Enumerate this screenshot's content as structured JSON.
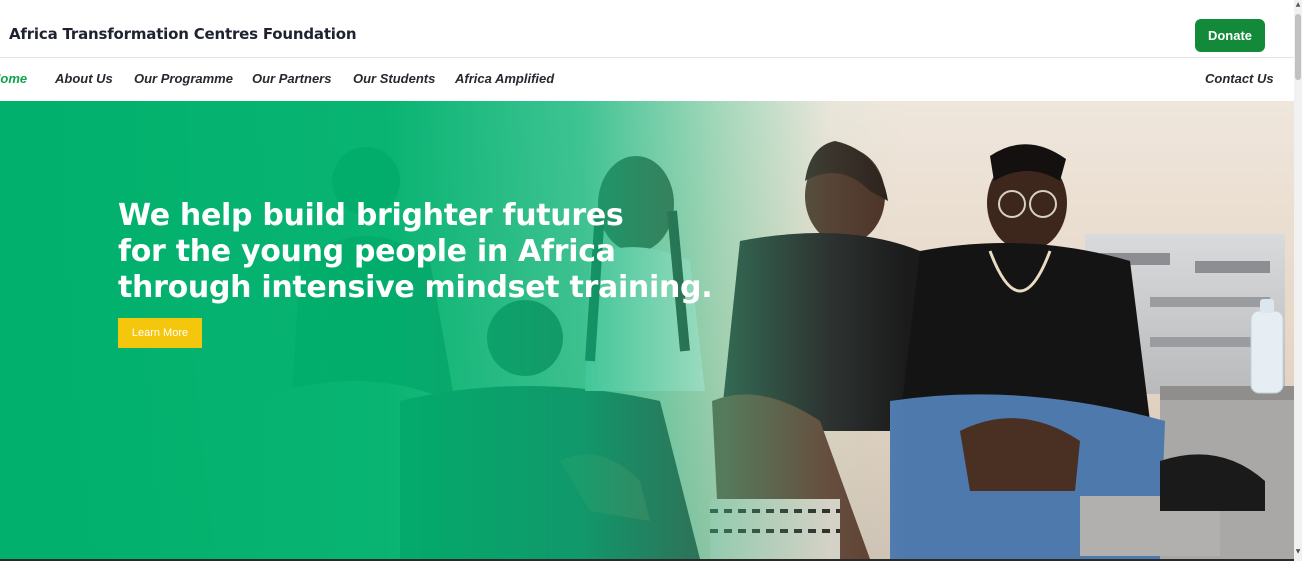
{
  "header": {
    "brand": "Africa Transformation Centres Foundation",
    "donate_label": "Donate"
  },
  "nav": {
    "items": [
      {
        "label": "Home",
        "active": true
      },
      {
        "label": "About Us",
        "active": false
      },
      {
        "label": "Our Programme",
        "active": false
      },
      {
        "label": "Our Partners",
        "active": false
      },
      {
        "label": "Our Students",
        "active": false
      },
      {
        "label": "Africa Amplified",
        "active": false
      }
    ],
    "contact_label": "Contact Us"
  },
  "hero": {
    "headline_lines": [
      "We help build brighter futures",
      "for the young people in Africa",
      "through intensive mindset training."
    ],
    "cta_label": "Learn More"
  },
  "colors": {
    "brand_green": "#138a3a",
    "hero_green": "#00b06c",
    "cta_yellow": "#f4c60c",
    "active_nav": "#0fa34d"
  }
}
